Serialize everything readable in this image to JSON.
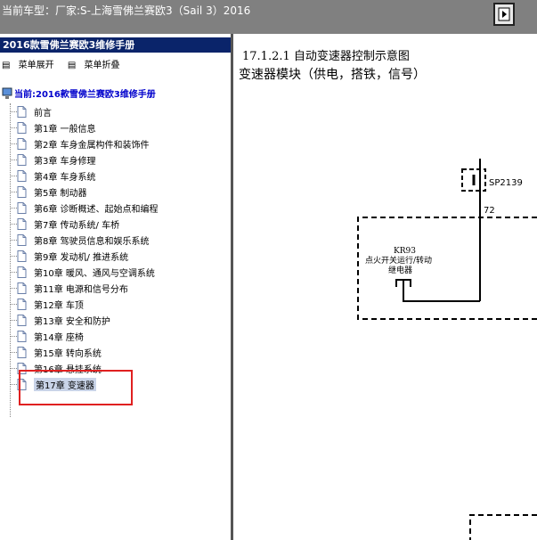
{
  "window": {
    "title": "当前车型：厂家:S-上海雪佛兰赛欧3（Sail 3）2016"
  },
  "sidebar": {
    "header": "2016款雪佛兰赛欧3维修手册",
    "expand_label": "菜单展开",
    "collapse_label": "菜单折叠",
    "root_label": "当前:2016款雪佛兰赛欧3维修手册",
    "items": [
      {
        "label": "前言"
      },
      {
        "label": "第1章 一般信息"
      },
      {
        "label": "第2章 车身金属构件和装饰件"
      },
      {
        "label": "第3章 车身修理"
      },
      {
        "label": "第4章 车身系统"
      },
      {
        "label": "第5章 制动器"
      },
      {
        "label": "第6章 诊断概述、起始点和编程"
      },
      {
        "label": "第7章 传动系统/ 车桥"
      },
      {
        "label": "第8章 驾驶员信息和娱乐系统"
      },
      {
        "label": "第9章 发动机/ 推进系统"
      },
      {
        "label": "第10章 暖风、通风与空调系统"
      },
      {
        "label": "第11章 电源和信号分布"
      },
      {
        "label": "第12章 车顶"
      },
      {
        "label": "第13章 安全和防护"
      },
      {
        "label": "第14章 座椅"
      },
      {
        "label": "第15章 转向系统"
      },
      {
        "label": "第16章 悬挂系统"
      },
      {
        "label": "第17章 变速器"
      }
    ],
    "selected_index": 17
  },
  "content": {
    "section_title": "17.1.2.1 自动变速器控制示意图",
    "subtitle": "变速器模块（供电，搭铁，信号）",
    "diagram": {
      "splice_label": "SP2139",
      "wire_label": "72",
      "relay_code": "KR93",
      "relay_name_line1": "点火开关运行/转动",
      "relay_name_line2": "继电器"
    }
  },
  "colors": {
    "topbar": "#808080",
    "sidebar_header": "#0a246a",
    "highlight": "#e02020",
    "root_text": "#0000cc"
  }
}
